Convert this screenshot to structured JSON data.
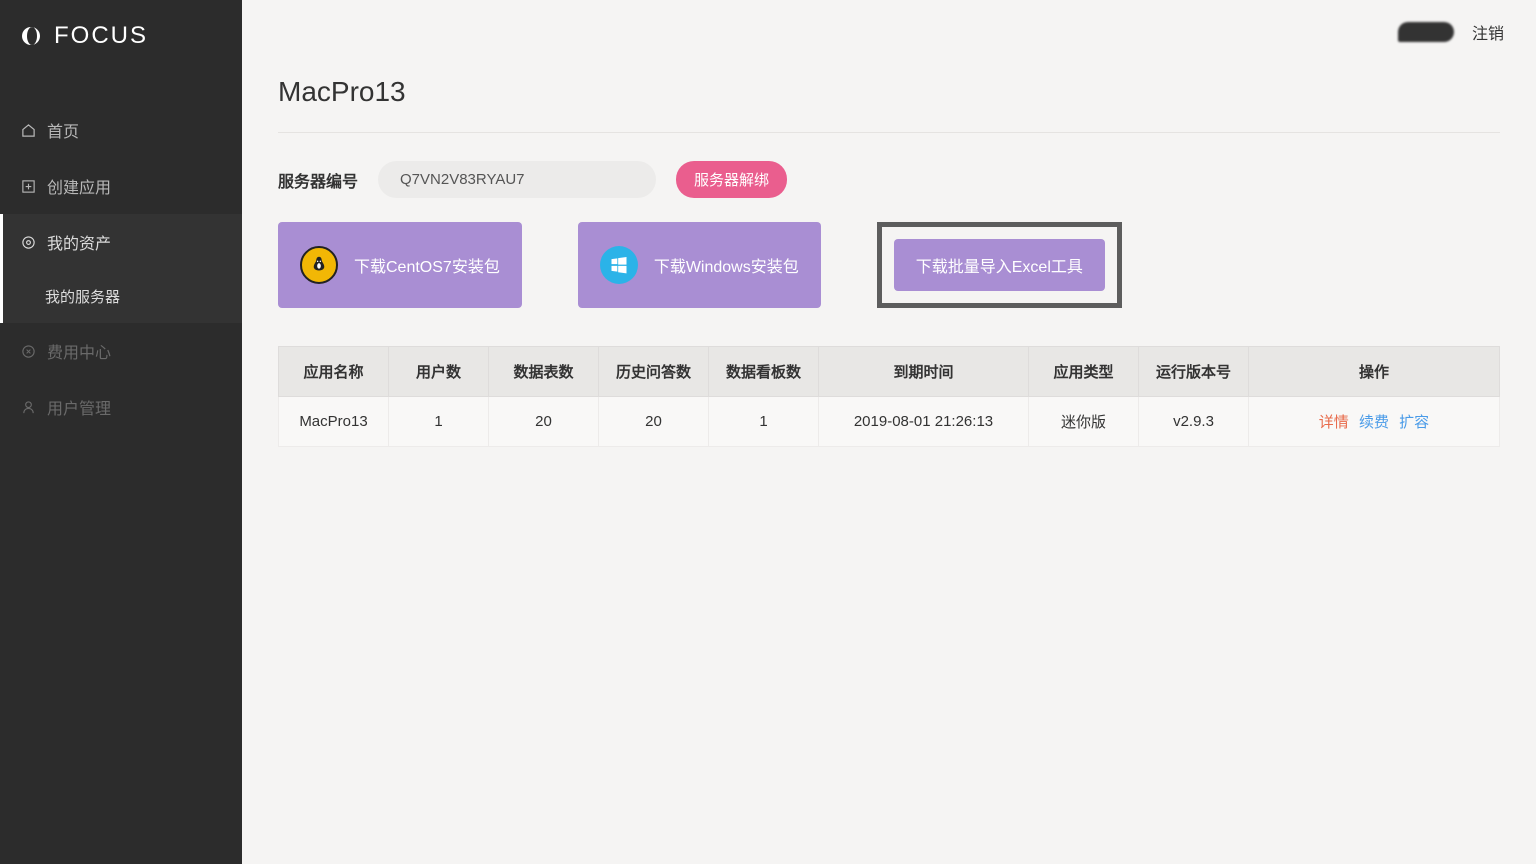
{
  "brand": "FOCUS",
  "topbar": {
    "logout": "注销"
  },
  "sidebar": {
    "home": "首页",
    "createApp": "创建应用",
    "myAssets": "我的资产",
    "myServers": "我的服务器",
    "feeCenter": "费用中心",
    "userMgmt": "用户管理"
  },
  "page": {
    "title": "MacPro13"
  },
  "server": {
    "label": "服务器编号",
    "code": "Q7VN2V83RYAU7",
    "unbindLabel": "服务器解绑"
  },
  "downloads": {
    "centos": "下载CentOS7安装包",
    "windows": "下载Windows安装包",
    "excel": "下载批量导入Excel工具"
  },
  "table": {
    "headers": {
      "appName": "应用名称",
      "userCount": "用户数",
      "tableCount": "数据表数",
      "qaCount": "历史问答数",
      "boardCount": "数据看板数",
      "expireTime": "到期时间",
      "appType": "应用类型",
      "version": "运行版本号",
      "action": "操作"
    },
    "rows": [
      {
        "appName": "MacPro13",
        "userCount": "1",
        "tableCount": "20",
        "qaCount": "20",
        "boardCount": "1",
        "expireTime": "2019-08-01 21:26:13",
        "appType": "迷你版",
        "version": "v2.9.3"
      }
    ],
    "actions": {
      "detail": "详情",
      "renew": "续费",
      "expand": "扩容"
    }
  }
}
